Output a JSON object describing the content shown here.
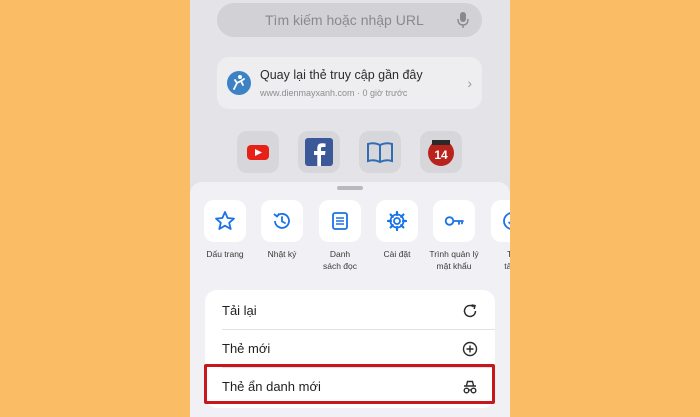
{
  "search": {
    "placeholder": "Tìm kiếm hoặc nhập URL"
  },
  "recent_tabs": {
    "title": "Quay lại thẻ truy cập gần đây",
    "subtitle": "www.dienmayxanh.com · 0 giờ trước"
  },
  "shortcuts": [
    {
      "name": "youtube"
    },
    {
      "name": "facebook"
    },
    {
      "name": "reading"
    },
    {
      "name": "kenh14",
      "badge": "14"
    }
  ],
  "actions": [
    {
      "label": "Dấu trang",
      "icon": "star-icon"
    },
    {
      "label": "Nhật ký",
      "icon": "history-icon"
    },
    {
      "label": "Danh\nsách đọc",
      "icon": "reading-list-icon"
    },
    {
      "label": "Cài đặt",
      "icon": "gear-icon"
    },
    {
      "label": "Trình quản lý\nmật khẩu",
      "icon": "key-icon"
    },
    {
      "label": "Tệ\ntải x",
      "icon": "download-icon"
    }
  ],
  "menu": [
    {
      "label": "Tải lại",
      "icon": "reload-icon"
    },
    {
      "label": "Thẻ mới",
      "icon": "plus-circle-icon"
    },
    {
      "label": "Thẻ ẩn danh mới",
      "icon": "incognito-icon"
    }
  ],
  "colors": {
    "background": "#fbbc66",
    "accent": "#1a73e8",
    "highlight": "#c8161d"
  }
}
